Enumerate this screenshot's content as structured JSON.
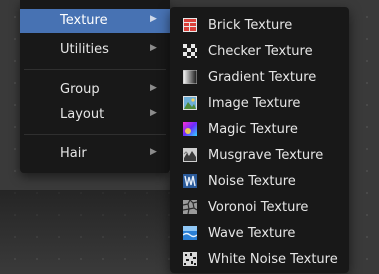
{
  "parent_menu": {
    "items": [
      {
        "label": "Texture",
        "arrow": "▶",
        "active": true
      },
      {
        "label": "Utilities",
        "arrow": "▶",
        "active": false
      },
      {
        "label": "Group",
        "arrow": "▶",
        "active": false
      },
      {
        "label": "Layout",
        "arrow": "▶",
        "active": false
      },
      {
        "label": "Hair",
        "arrow": "▶",
        "active": false
      }
    ]
  },
  "texture_menu": {
    "items": [
      {
        "label": "Brick Texture",
        "icon": "brick-texture-icon"
      },
      {
        "label": "Checker Texture",
        "icon": "checker-texture-icon"
      },
      {
        "label": "Gradient Texture",
        "icon": "gradient-texture-icon"
      },
      {
        "label": "Image Texture",
        "icon": "image-texture-icon"
      },
      {
        "label": "Magic Texture",
        "icon": "magic-texture-icon"
      },
      {
        "label": "Musgrave Texture",
        "icon": "musgrave-texture-icon"
      },
      {
        "label": "Noise Texture",
        "icon": "noise-texture-icon"
      },
      {
        "label": "Voronoi Texture",
        "icon": "voronoi-texture-icon"
      },
      {
        "label": "Wave Texture",
        "icon": "wave-texture-icon"
      },
      {
        "label": "White Noise Texture",
        "icon": "white-noise-texture-icon"
      }
    ]
  },
  "colors": {
    "menu_bg": "#181818",
    "highlight": "#4772b3",
    "text": "#e6e6e6"
  }
}
